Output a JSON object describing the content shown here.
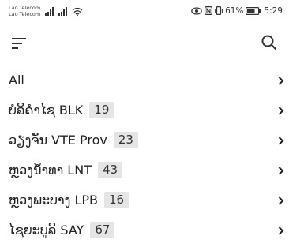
{
  "status_bar": {
    "carrier_1": "Lao Telecom",
    "carrier_2": "Lao Telecom",
    "battery_percent": "61%",
    "time": "5:29"
  },
  "toolbar": {
    "menu_icon": "sort-menu-icon",
    "search_icon": "search-icon"
  },
  "list": {
    "items": [
      {
        "label": "All",
        "count": ""
      },
      {
        "label": "ບໍລິຄໍາໄຊ BLK",
        "count": "19"
      },
      {
        "label": "ວຽງຈັນ VTE Prov",
        "count": "23"
      },
      {
        "label": "ຫຼວງນ້ຳທາ LNT",
        "count": "43"
      },
      {
        "label": "ຫຼວງພະບາງ LPB",
        "count": "16"
      },
      {
        "label": "ໄຊຍະບູລີ SAY",
        "count": "67"
      }
    ]
  },
  "colors": {
    "badge_bg": "#e5e5e5",
    "divider": "#e6e6e6",
    "text": "#222222"
  }
}
